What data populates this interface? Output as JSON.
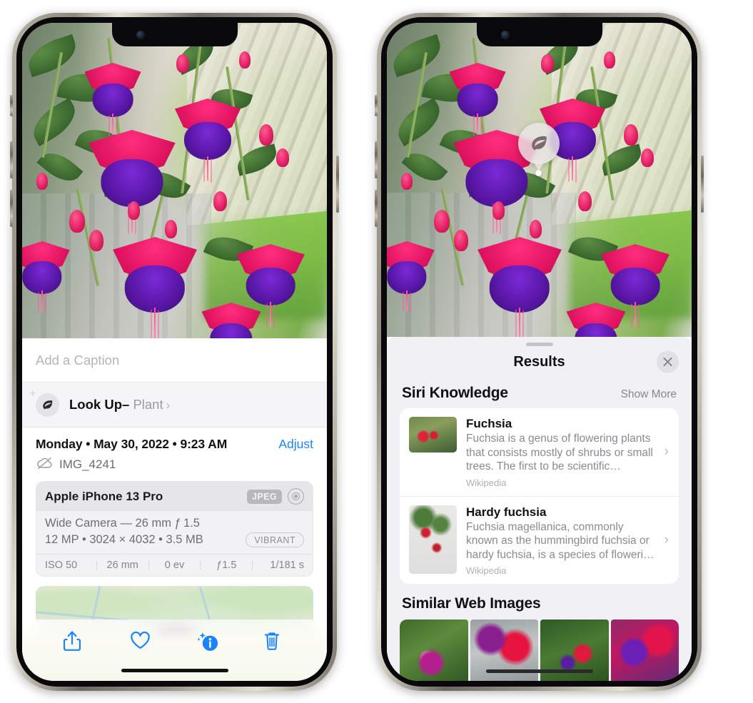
{
  "left_phone": {
    "caption_placeholder": "Add a Caption",
    "lookup": {
      "label": "Look Up",
      "dash": "–",
      "subject": "Plant",
      "chevron": "›",
      "icon": "leaf-icon"
    },
    "meta": {
      "date": "Monday • May 30, 2022 • 9:23 AM",
      "adjust_label": "Adjust",
      "filename": "IMG_4241",
      "cloud_icon": "cloud-slash-icon"
    },
    "exif": {
      "device": "Apple iPhone 13 Pro",
      "format_badge": "JPEG",
      "lens_icon": "aperture-icon",
      "lens_line": "Wide Camera — 26 mm ƒ 1.5",
      "size_line": "12 MP • 3024 × 4032 • 3.5 MB",
      "style_badge": "VIBRANT",
      "stats": [
        "ISO 50",
        "26 mm",
        "0 ev",
        "ƒ1.5",
        "1/181 s"
      ]
    },
    "toolbar": [
      {
        "name": "share-icon",
        "label": "Share"
      },
      {
        "name": "heart-icon",
        "label": "Favorite"
      },
      {
        "name": "info-sparkle-icon",
        "label": "Info"
      },
      {
        "name": "trash-icon",
        "label": "Delete"
      }
    ]
  },
  "right_phone": {
    "visual_lookup_badge_icon": "leaf-icon",
    "sheet": {
      "title": "Results",
      "close_icon": "close-icon"
    },
    "siri_knowledge": {
      "title": "Siri Knowledge",
      "show_more": "Show More",
      "items": [
        {
          "title": "Fuchsia",
          "description": "Fuchsia is a genus of flowering plants that consists mostly of shrubs or small trees. The first to be scientific…",
          "source": "Wikipedia",
          "chevron": "›"
        },
        {
          "title": "Hardy fuchsia",
          "description": "Fuchsia magellanica, commonly known as the hummingbird fuchsia or hardy fuchsia, is a species of floweri…",
          "source": "Wikipedia",
          "chevron": "›"
        }
      ]
    },
    "similar_web_images": {
      "title": "Similar Web Images",
      "thumbnails": [
        "fuchsia-photo-1",
        "fuchsia-photo-2",
        "fuchsia-photo-3",
        "fuchsia-photo-4"
      ]
    }
  },
  "colors": {
    "accent_blue": "#1a84ff",
    "sheet_bg": "#f0f0f5",
    "card_bg": "#ffffff",
    "secondary_text": "#8a8a92"
  }
}
